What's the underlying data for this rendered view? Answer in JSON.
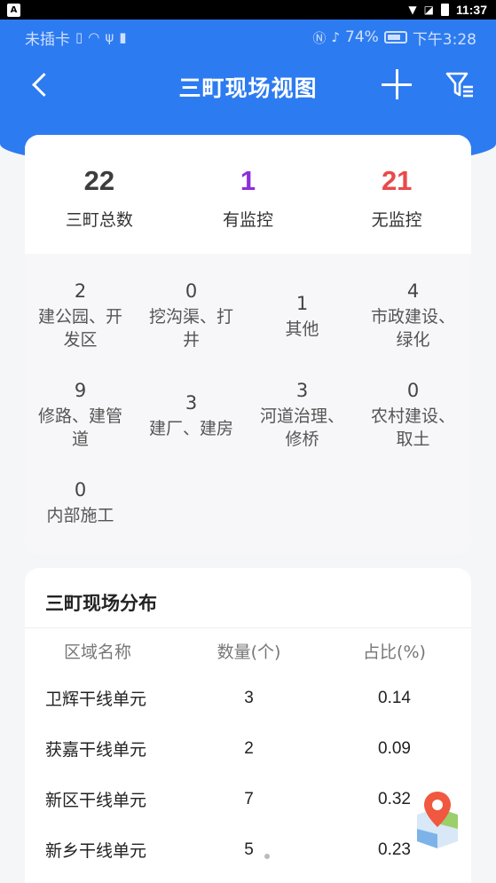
{
  "os_status": {
    "app_badge": "A",
    "time": "11:37"
  },
  "phone_status": {
    "carrier": "未插卡",
    "battery": "74%",
    "time": "下午3:28"
  },
  "nav": {
    "title": "三町现场视图"
  },
  "totals": [
    {
      "value": "22",
      "label": "三町总数",
      "color": "#3d3d3d"
    },
    {
      "value": "1",
      "label": "有监控",
      "color": "#8b2fdb"
    },
    {
      "value": "21",
      "label": "无监控",
      "color": "#e84a4a"
    }
  ],
  "categories": [
    {
      "value": "2",
      "label": "建公园、开发区"
    },
    {
      "value": "0",
      "label": "挖沟渠、打井"
    },
    {
      "value": "1",
      "label": "其他"
    },
    {
      "value": "4",
      "label": "市政建设、绿化"
    },
    {
      "value": "9",
      "label": "修路、建管道"
    },
    {
      "value": "3",
      "label": "建厂、建房"
    },
    {
      "value": "3",
      "label": "河道治理、修桥"
    },
    {
      "value": "0",
      "label": "农村建设、取土"
    },
    {
      "value": "0",
      "label": "内部施工"
    }
  ],
  "distribution": {
    "title": "三町现场分布",
    "headers": [
      "区域名称",
      "数量(个)",
      "占比(%)"
    ],
    "rows": [
      {
        "name": "卫辉干线单元",
        "count": "3",
        "ratio": "0.14"
      },
      {
        "name": "获嘉干线单元",
        "count": "2",
        "ratio": "0.09"
      },
      {
        "name": "新区干线单元",
        "count": "7",
        "ratio": "0.32"
      },
      {
        "name": "新乡干线单元",
        "count": "5",
        "ratio": "0.23"
      }
    ]
  },
  "colors": {
    "primary": "#2d7bf0",
    "accent_purple": "#8b2fdb",
    "accent_red": "#e84a4a"
  }
}
